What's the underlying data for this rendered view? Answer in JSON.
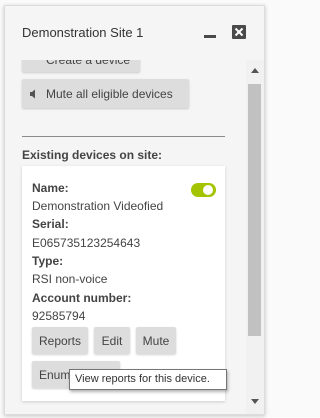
{
  "window": {
    "title": "Demonstration Site 1"
  },
  "actions": {
    "create_device": "Create a device",
    "mute_all": "Mute all eligible devices"
  },
  "devices_section": {
    "title": "Existing devices on site:"
  },
  "device": {
    "name_label": "Name:",
    "name": "Demonstration Videofied",
    "enabled": true,
    "serial_label": "Serial:",
    "serial": "E065735123254643",
    "type_label": "Type:",
    "type": "RSI non-voice",
    "account_label": "Account number:",
    "account": "92585794",
    "buttons": {
      "reports": "Reports",
      "edit": "Edit",
      "mute": "Mute",
      "enumerations": "Enumerations"
    }
  },
  "tooltip": "View reports for this device.",
  "colors": {
    "toggle_on": "#a4c400",
    "button_bg": "#dddddd",
    "scroll_thumb": "#c1c1c1"
  },
  "icons": {
    "minimize": "minimize-icon",
    "close": "close-icon",
    "plus": "plus-icon",
    "mute": "speaker-icon"
  }
}
